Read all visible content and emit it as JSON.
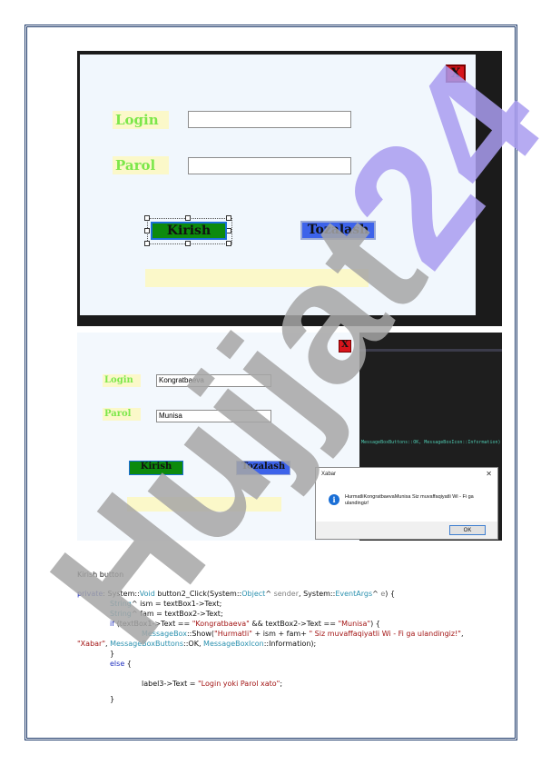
{
  "screenshot1": {
    "close_label": "X",
    "login_label": "Login",
    "parol_label": "Parol",
    "login_value": "",
    "parol_value": "",
    "kirish_label": "Kirish",
    "tozalash_label": "Tozalash"
  },
  "screenshot2": {
    "close_label": "X",
    "login_label": "Login",
    "parol_label": "Parol",
    "login_value": "Kongratbaeva",
    "parol_value": "Munisa",
    "kirish_label": "Kirish",
    "tozalash_label": "Tozalash",
    "ide_code_text": "MessageBoxButtons::OK, MessageBoxIcon::Information)",
    "messagebox": {
      "title": "Xabar",
      "close_glyph": "✕",
      "icon_glyph": "i",
      "text": "HurmatliKongratbaevaMunisa Siz muvaffaqiyatli Wi - Fi ga ulandingiz!",
      "ok_label": "OK"
    }
  },
  "caption": "Kirish button",
  "code": {
    "l1": {
      "a": "private",
      "b": ": System::",
      "c": "Void",
      "d": " button2_Click(System::",
      "e": "Object",
      "f": "^ ",
      "g": "sender",
      "h": ", System::",
      "i": "EventArgs",
      "j": "^ ",
      "k": "e",
      "l": ") {"
    },
    "l2": {
      "a": "String",
      "b": "^ ism = textBox1->Text;"
    },
    "l3": {
      "a": "String",
      "b": "^ fam = textBox2->Text;"
    },
    "l4": {
      "a": "if",
      "b": " (textBox1->Text == ",
      "c": "\"Kongratbaeva\"",
      "d": " && textBox2->Text == ",
      "e": "\"Munisa\"",
      "f": ") {"
    },
    "l5": {
      "a": "MessageBox",
      "b": "::Show(",
      "c": "\"Hurmatli\"",
      "d": " + ism + fam+ ",
      "e": "\" Siz muvaffaqiyatli Wi - Fi ga ulandingiz!\"",
      "f": ","
    },
    "l6": {
      "a": "\"Xabar\"",
      "b": ", ",
      "c": "MessageBoxButtons",
      "d": "::OK, ",
      "e": "MessageBoxIcon",
      "f": "::Information);"
    },
    "l7": "}",
    "l8": {
      "a": "else",
      "b": " {"
    },
    "l9": {
      "a": "label3->Text = ",
      "b": "\"Login yoki Parol xato\"",
      "c": ";"
    },
    "l10": "}"
  },
  "watermark": "Hujjat24",
  "colors": {
    "border": "#1f3b6b",
    "label_bg": "#fbf8c9",
    "label_text": "#7ce74a",
    "green_button": "#0d8a0d",
    "blue_button": "#3d63ea",
    "close_button": "#d8141b",
    "keyword": "#1f2fbf",
    "type": "#2b91af",
    "string": "#a31515",
    "watermark_grey": "#a6a6a6",
    "watermark_violet": "#a99cf0"
  }
}
